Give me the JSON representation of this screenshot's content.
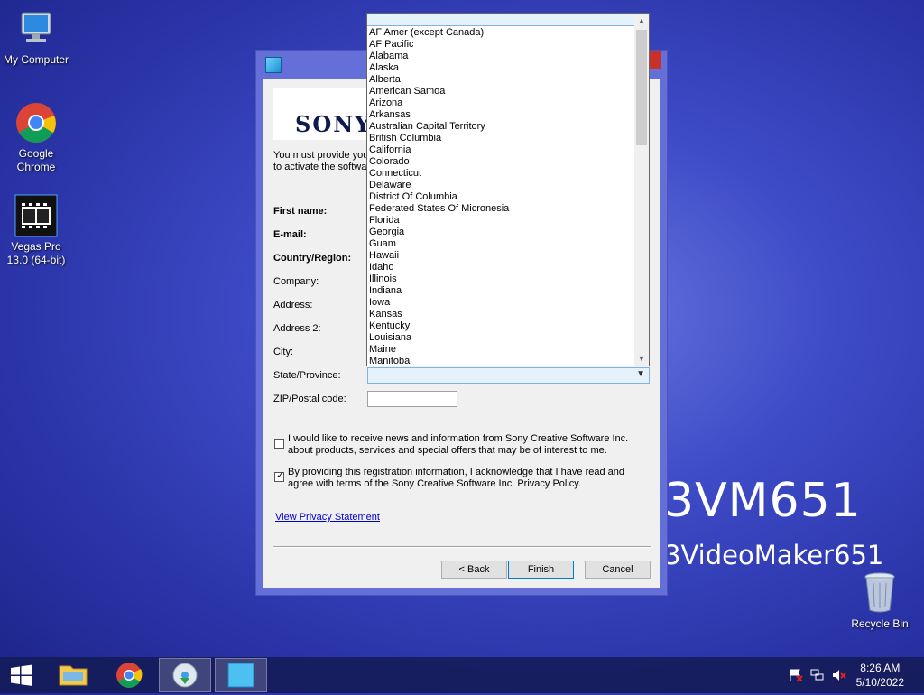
{
  "desktop": {
    "icons": [
      {
        "label": "My Computer"
      },
      {
        "label": "Google Chrome"
      },
      {
        "label": "Vegas Pro 13.0 (64-bit)"
      }
    ],
    "watermark_line1": "3VM651",
    "watermark_line2": "3VideoMaker651",
    "recycle_bin_label": "Recycle Bin"
  },
  "dialog": {
    "logo": "SONY",
    "intro_line1": "You must provide your",
    "intro_line2": "to activate the softwar",
    "labels": {
      "first_name": "First name:",
      "email": "E-mail:",
      "country": "Country/Region:",
      "company": "Company:",
      "address": "Address:",
      "address2": "Address 2:",
      "city": "City:",
      "state": "State/Province:",
      "zip": "ZIP/Postal code:"
    },
    "state_value": "",
    "zip_value": "",
    "news_checkbox_checked": false,
    "news_text": "I would like to receive news and information from Sony Creative Software Inc. about products, services and special offers that may be of interest to me.",
    "ack_checkbox_checked": true,
    "ack_text": "By providing this registration information, I acknowledge that I have read and agree with terms of the Sony Creative Software Inc. Privacy Policy.",
    "privacy_link": "View Privacy Statement",
    "buttons": {
      "back": "< Back",
      "finish": "Finish",
      "cancel": "Cancel"
    }
  },
  "state_dropdown": {
    "items": [
      "AF Amer (except Canada)",
      "AF Pacific",
      "Alabama",
      "Alaska",
      "Alberta",
      "American Samoa",
      "Arizona",
      "Arkansas",
      "Australian Capital Territory",
      "British Columbia",
      "California",
      "Colorado",
      "Connecticut",
      "Delaware",
      "District Of Columbia",
      "Federated States Of Micronesia",
      "Florida",
      "Georgia",
      "Guam",
      "Hawaii",
      "Idaho",
      "Illinois",
      "Indiana",
      "Iowa",
      "Kansas",
      "Kentucky",
      "Louisiana",
      "Maine",
      "Manitoba"
    ]
  },
  "taskbar": {
    "time": "8:26 AM",
    "date": "5/10/2022"
  }
}
